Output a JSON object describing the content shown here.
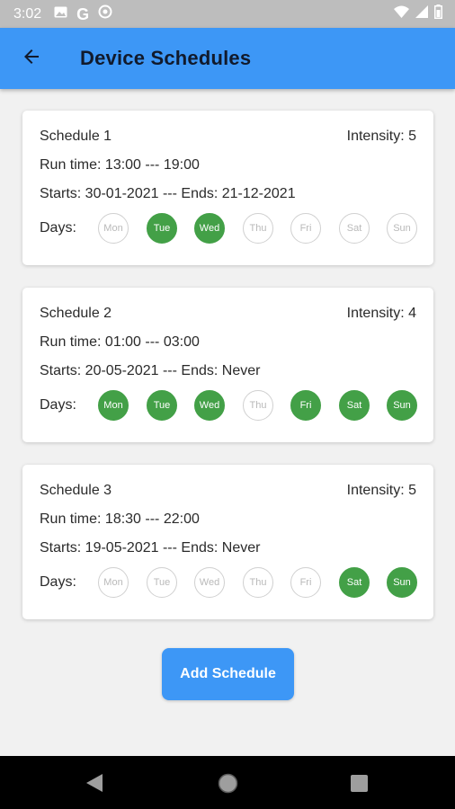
{
  "status_bar": {
    "time": "3:02"
  },
  "app_bar": {
    "title": "Device Schedules"
  },
  "days_label": "Days:",
  "schedules": [
    {
      "name": "Schedule 1",
      "intensity": "Intensity: 5",
      "run_time": "Run time: 13:00 --- 19:00",
      "dates": "Starts: 30-01-2021 --- Ends: 21-12-2021",
      "days": [
        {
          "label": "Mon",
          "active": false
        },
        {
          "label": "Tue",
          "active": true
        },
        {
          "label": "Wed",
          "active": true
        },
        {
          "label": "Thu",
          "active": false
        },
        {
          "label": "Fri",
          "active": false
        },
        {
          "label": "Sat",
          "active": false
        },
        {
          "label": "Sun",
          "active": false
        }
      ]
    },
    {
      "name": "Schedule 2",
      "intensity": "Intensity: 4",
      "run_time": "Run time: 01:00 --- 03:00",
      "dates": "Starts: 20-05-2021 --- Ends: Never",
      "days": [
        {
          "label": "Mon",
          "active": true
        },
        {
          "label": "Tue",
          "active": true
        },
        {
          "label": "Wed",
          "active": true
        },
        {
          "label": "Thu",
          "active": false
        },
        {
          "label": "Fri",
          "active": true
        },
        {
          "label": "Sat",
          "active": true
        },
        {
          "label": "Sun",
          "active": true
        }
      ]
    },
    {
      "name": "Schedule 3",
      "intensity": "Intensity: 5",
      "run_time": "Run time: 18:30 --- 22:00",
      "dates": "Starts: 19-05-2021 --- Ends: Never",
      "days": [
        {
          "label": "Mon",
          "active": false
        },
        {
          "label": "Tue",
          "active": false
        },
        {
          "label": "Wed",
          "active": false
        },
        {
          "label": "Thu",
          "active": false
        },
        {
          "label": "Fri",
          "active": false
        },
        {
          "label": "Sat",
          "active": true
        },
        {
          "label": "Sun",
          "active": true
        }
      ]
    }
  ],
  "add_button_label": "Add Schedule",
  "colors": {
    "primary": "#3d97f6",
    "day_active": "#43a047",
    "day_inactive_border": "#d0d0d0"
  },
  "icons": {
    "status": [
      "image-icon",
      "google-icon",
      "sync-icon",
      "wifi-icon",
      "signal-icon",
      "battery-icon"
    ],
    "app_bar": "arrow-back-icon",
    "nav": [
      "nav-back-icon",
      "nav-home-icon",
      "nav-recents-icon"
    ]
  }
}
